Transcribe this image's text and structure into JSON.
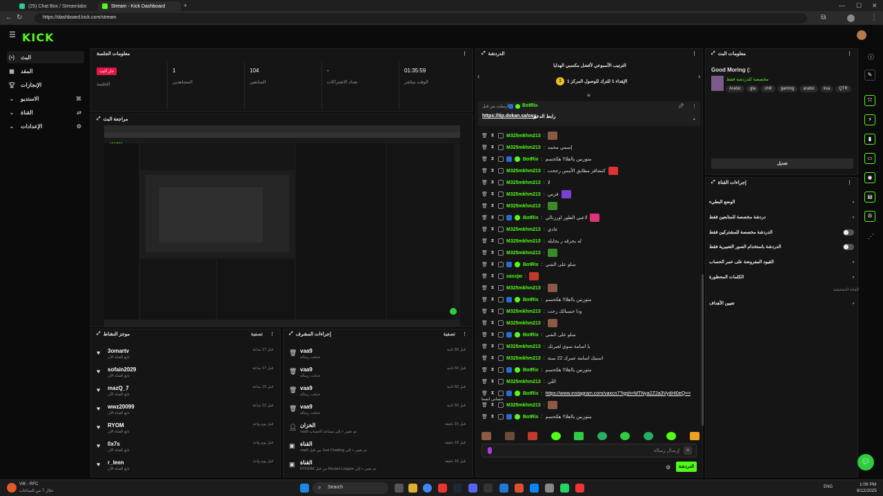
{
  "browser": {
    "tabs": [
      {
        "label": "(25) Chat Box / Streamlabs"
      },
      {
        "label": "Stream - Kick Dashboard"
      }
    ],
    "url": "https://dashboard.kick.com/stream"
  },
  "app": {
    "logo": "KICK"
  },
  "sidebar": {
    "items": [
      {
        "label": "البث",
        "icon": "broadcast-icon"
      },
      {
        "label": "المقد",
        "icon": "library-icon"
      },
      {
        "label": "الإنجازات",
        "icon": "trophy-icon"
      },
      {
        "label": "الاستديو",
        "icon": "studio-icon"
      },
      {
        "label": "القناة",
        "icon": "channel-icon"
      },
      {
        "label": "الإعدادات",
        "icon": "gear-icon"
      }
    ]
  },
  "session": {
    "title": "معلومات الجلسة",
    "live_badge": "جار البث",
    "stats": [
      {
        "label": "الجلسة",
        "value": ""
      },
      {
        "label": "المشاهدين",
        "value": "1"
      },
      {
        "label": "المتابعين",
        "value": "104"
      },
      {
        "label": "تعداد الاشتراكات",
        "value": "-"
      },
      {
        "label": "الوقت مباشر",
        "value": "01:35:59"
      }
    ]
  },
  "preview": {
    "title": "مراجعة البث"
  },
  "activity": {
    "title": "موجز النشاط",
    "filter": "تصفية",
    "items": [
      {
        "name": "3omartv",
        "sub": "تابع القناة الآن",
        "time": "قبل 17 ساعة"
      },
      {
        "name": "sofain2029",
        "sub": "تابع القناة الآن",
        "time": "قبل 17 ساعة"
      },
      {
        "name": "mazQ_7",
        "sub": "تابع القناة الآن",
        "time": "قبل 19 ساعة"
      },
      {
        "name": "wwz20099",
        "sub": "تابع القناة الآن",
        "time": "قبل 22 ساعة"
      },
      {
        "name": "RYOM",
        "sub": "تابع القناة الآن",
        "time": "قبل يوم واحد"
      },
      {
        "name": "0x7s",
        "sub": "تابع القناة الآن",
        "time": "قبل يوم واحد"
      },
      {
        "name": "r_leen",
        "sub": "تابع القناة الآن",
        "time": "قبل يوم واحد"
      }
    ]
  },
  "modlog": {
    "title": "إجراءات المشرف",
    "filter": "تصفية",
    "items": [
      {
        "name": "vaa9",
        "sub": "حذفت رسالة",
        "time": "قبل 50 ثانية",
        "icon": "trash-icon"
      },
      {
        "name": "vaa9",
        "sub": "حذفت رسالة",
        "time": "قبل 50 ثانية",
        "icon": "trash-icon"
      },
      {
        "name": "vaa9",
        "sub": "حذفت رسالة",
        "time": "قبل 50 ثانية",
        "icon": "trash-icon"
      },
      {
        "name": "vaa9",
        "sub": "حذفت رسالة",
        "time": "قبل 50 ثانية",
        "icon": "trash-icon"
      },
      {
        "name": "الخزان",
        "sub": "vaa9 تم تغيير « إلى مساعد الحساب",
        "time": "قبل 15 دقيقة",
        "icon": "user-edit-icon"
      },
      {
        "name": "القناة",
        "sub": "vaa9 من قبل Just Chatting تم تغيير « إلى",
        "time": "قبل 16 دقيقة",
        "icon": "category-icon"
      },
      {
        "name": "القناة",
        "sub": "RYOOM من قبل Rocket League تم تغيير « إلى",
        "time": "قبل 16 دقيقة",
        "icon": "category-icon"
      }
    ]
  },
  "chat": {
    "title": "الدردشة",
    "banner": {
      "line1": "الترتيب الأسبوعي لأفضل مكسبي الهدايا",
      "line2": "الإهداء 1 للترك للوصول المركز 1",
      "rank": "1"
    },
    "pinned": {
      "user": "BotRix",
      "by": "أرسلت من قبل",
      "title": "رابط الدعم",
      "link": "https://tip.dokan.sa/osu"
    },
    "messages": [
      {
        "user": "M325mkhm213",
        "text": "",
        "emote": "#8a5a44"
      },
      {
        "user": "M325mkhm213",
        "text": "إسمي محمد"
      },
      {
        "user": "BotRix",
        "text": "متورنين يااهلا!! هكحسم",
        "bot": true
      },
      {
        "user": "M325mkhm213",
        "text": "كتشافر مطابق الأمس رجحت",
        "emote": "#d33"
      },
      {
        "user": "M325mkhm213",
        "text": "لا"
      },
      {
        "user": "M325mkhm213",
        "text": "فرس",
        "emote": "#7b3fd1"
      },
      {
        "user": "M325mkhm213",
        "text": "",
        "emote": "#3a8a2a"
      },
      {
        "user": "BotRix",
        "text": "لاعبي الطور اورزنالي",
        "bot": true,
        "emote": "#e0347a"
      },
      {
        "user": "M325mkhm213",
        "text": "عادي"
      },
      {
        "user": "M325mkhm213",
        "text": "له يحرقه ر يحايله"
      },
      {
        "user": "M325mkhm213",
        "text": "",
        "emote": "#3a8a2a"
      },
      {
        "user": "BotRix",
        "text": "سلو على الشي",
        "bot": true
      },
      {
        "user": "xasxjw",
        "text": "",
        "emote": "#c0392b"
      },
      {
        "user": "M325mkhm213",
        "text": "",
        "emote": "#8a5a44"
      },
      {
        "user": "BotRix",
        "text": "متورنين يااهلا!! هكحسم",
        "bot": true
      },
      {
        "user": "M325mkhm213",
        "text": "وذا حسبالك رحت"
      },
      {
        "user": "M325mkhm213",
        "text": "",
        "emote": "#8a5a44"
      },
      {
        "user": "BotRix",
        "text": "سلو على الشي",
        "bot": true
      },
      {
        "user": "M325mkhm213",
        "text": "يا اسامة سوي لعبرتك"
      },
      {
        "user": "M325mkhm213",
        "text": "اسمك اسامة عمرك 22 سنة"
      },
      {
        "user": "BotRix",
        "text": "متورنين يااهلا!! هكحسم",
        "bot": true
      },
      {
        "user": "M325mkhm213",
        "text": "اللي"
      },
      {
        "user": "BotRix",
        "text": "https://www.instagram.com/vaxcn7?igsh=MTNya2Z2a3VydHl0eQ==",
        "bot": true,
        "link": true
      },
      {
        "user": "M325mkhm213",
        "text": "",
        "emote": "#8a5a44"
      },
      {
        "user": "BotRix",
        "text": "متورنين يااهلا!! هكحسم",
        "bot": true
      }
    ],
    "overflow_line": "حسابي انستا",
    "input_placeholder": "إرسال رسالة",
    "send_label": "الدردشة"
  },
  "stream_info": {
    "title": "معلومات البث",
    "stream_title": "Good Moring (:",
    "category": "مخصصة للدردشة فقط",
    "tags": [
      "Arabic",
      "gta",
      "chill",
      "gaming",
      "arabic",
      "ksa",
      "QTR"
    ],
    "edit_label": "تعديل"
  },
  "channel_actions": {
    "title": "إجراءات القناة",
    "rows": [
      {
        "label": "الوضع البطيء",
        "type": "chevron"
      },
      {
        "label": "دردشة مخصصة للمتابعين فقط",
        "type": "chevron"
      },
      {
        "label": "الدردشة مخصصة للمشتركين فقط",
        "type": "toggle"
      },
      {
        "label": "الدردشة باستخدام الصور التعبيرية فقط",
        "type": "toggle"
      },
      {
        "label": "القيود المفروضة على عمر الحساب",
        "type": "chevron"
      },
      {
        "label": "الكلمات المحظورة",
        "type": "chevron"
      }
    ],
    "section_label": "القناة التشغيلية",
    "goals_label": "تعيين الأهداف"
  },
  "taskbar": {
    "weather_temp": "VIK - RFC",
    "weather_sub": "خلال 7 من الساعات",
    "search": "Search",
    "lang": "ENG",
    "time": "1:09 PM",
    "date": "8/12/2025"
  },
  "colors": {
    "accent": "#53fc18",
    "live": "#e3164b",
    "link": "#ffffff"
  }
}
